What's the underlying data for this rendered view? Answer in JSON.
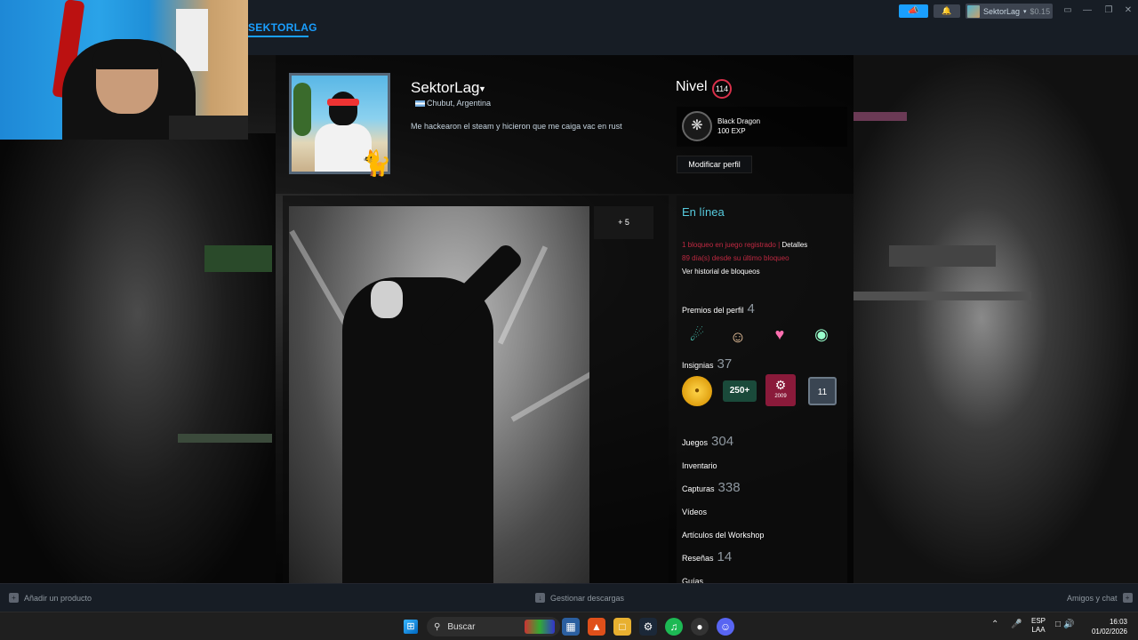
{
  "header": {
    "nav_active": "SEKTORLAG",
    "account_name": "SektorLag",
    "account_balance": "$0.15",
    "announce_icon": "megaphone-icon",
    "notif_icon": "bell-icon"
  },
  "profile": {
    "persona_name": "SektorLag",
    "location": "Chubut, Argentina",
    "summary": "Me hackearon el steam y hicieron que me caiga vac en rust",
    "level_label": "Nivel",
    "level": "114",
    "favorite_badge": {
      "name": "Black Dragon",
      "xp": "100 EXP"
    },
    "edit_button": "Modificar perfil"
  },
  "showcase": {
    "more_label": "+ 5"
  },
  "sidebar": {
    "status": "En línea",
    "ban_line1": "1 bloqueo en juego registrado | ",
    "ban_details": "Detalles",
    "ban_line2": "89 día(s) desde su último bloqueo",
    "ban_history": "Ver historial de bloqueos",
    "awards_label": "Premios del perfil",
    "awards_count": "4",
    "badges_label": "Insignias",
    "badges_count": "37",
    "badge_250": "250+",
    "badge_years": "11",
    "badge_steam_year": "2009",
    "games_label": "Juegos",
    "games_count": "304",
    "inventory_label": "Inventario",
    "screenshots_label": "Capturas",
    "screenshots_count": "338",
    "videos_label": "Vídeos",
    "workshop_label": "Artículos del Workshop",
    "reviews_label": "Reseñas",
    "reviews_count": "14",
    "guides_label": "Guías"
  },
  "steam_bottom": {
    "add_product": "Añadir un producto",
    "manage_downloads": "Gestionar descargas",
    "friends_chat": "Amigos y chat"
  },
  "taskbar": {
    "search_placeholder": "Buscar",
    "lang_top": "ESP",
    "lang_bottom": "LAA",
    "time": "16:03",
    "date": "01/02/2026"
  },
  "colors": {
    "accent": "#1a9fff",
    "online": "#57cbde",
    "ban_red": "#c02942",
    "level_ring": "#d9304a"
  }
}
